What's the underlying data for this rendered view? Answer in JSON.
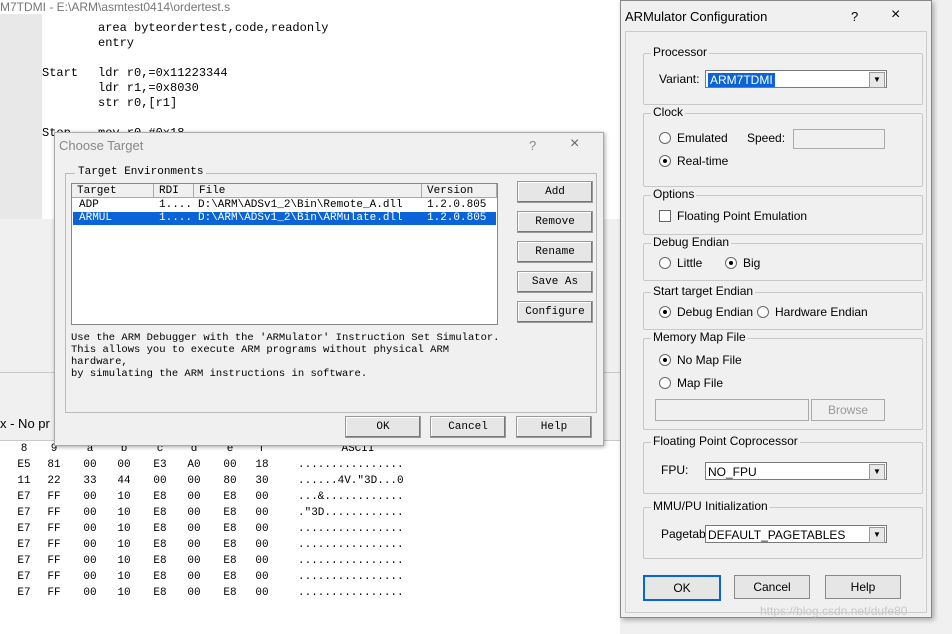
{
  "background": {
    "title": "M7TDMI - E:\\ARM\\asmtest0414\\ordertest.s",
    "code": [
      {
        "label": "",
        "text": "area byteordertest,code,readonly"
      },
      {
        "label": "",
        "text": "entry"
      },
      {
        "label": "",
        "text": ""
      },
      {
        "label": "Start",
        "text": "ldr r0,=0x11223344"
      },
      {
        "label": "",
        "text": "ldr r1,=0x8030"
      },
      {
        "label": "",
        "text": "str r0,[r1]"
      },
      {
        "label": "",
        "text": ""
      },
      {
        "label": "Stop",
        "text": "mov r0,#0x18"
      }
    ],
    "status_text": "x - No pr",
    "memory": {
      "headers": [
        "8",
        "9",
        "a",
        "b",
        "c",
        "d",
        "e",
        "f",
        "ASCII"
      ],
      "rows": [
        [
          "E5",
          "81",
          "00",
          "00",
          "E3",
          "A0",
          "00",
          "18",
          "................"
        ],
        [
          "11",
          "22",
          "33",
          "44",
          "00",
          "00",
          "80",
          "30",
          "......4V.\"3D...0"
        ],
        [
          "E7",
          "FF",
          "00",
          "10",
          "E8",
          "00",
          "E8",
          "00",
          "...&............"
        ],
        [
          "E7",
          "FF",
          "00",
          "10",
          "E8",
          "00",
          "E8",
          "00",
          ".\"3D............"
        ],
        [
          "E7",
          "FF",
          "00",
          "10",
          "E8",
          "00",
          "E8",
          "00",
          "................"
        ],
        [
          "E7",
          "FF",
          "00",
          "10",
          "E8",
          "00",
          "E8",
          "00",
          "................"
        ],
        [
          "E7",
          "FF",
          "00",
          "10",
          "E8",
          "00",
          "E8",
          "00",
          "................"
        ],
        [
          "E7",
          "FF",
          "00",
          "10",
          "E8",
          "00",
          "E8",
          "00",
          "................"
        ],
        [
          "E7",
          "FF",
          "00",
          "10",
          "E8",
          "00",
          "E8",
          "00",
          "................"
        ]
      ]
    }
  },
  "choose_target": {
    "title": "Choose Target",
    "help": "?",
    "close": "×",
    "group_label": "Target Environments",
    "columns": [
      "Target",
      "RDI",
      "File",
      "Version"
    ],
    "rows": [
      {
        "target": "ADP",
        "rdi": "1....",
        "file": "D:\\ARM\\ADSv1_2\\Bin\\Remote_A.dll",
        "version": "1.2.0.805"
      },
      {
        "target": "ARMUL",
        "rdi": "1....",
        "file": "D:\\ARM\\ADSv1_2\\Bin\\ARMulate.dll",
        "version": "1.2.0.805"
      }
    ],
    "buttons": [
      "Add",
      "Remove",
      "Rename",
      "Save As",
      "Configure"
    ],
    "description": [
      "Use the ARM Debugger with the 'ARMulator' Instruction Set Simulator.",
      "This allows you to execute ARM programs without physical ARM hardware,",
      "by simulating the ARM instructions in software."
    ],
    "ok": "OK",
    "cancel": "Cancel",
    "help_btn": "Help"
  },
  "armulator": {
    "title": "ARMulator Configuration",
    "help": "?",
    "close": "×",
    "processor": {
      "label": "Processor",
      "variant_label": "Variant:",
      "variant": "ARM7TDMI"
    },
    "clock": {
      "label": "Clock",
      "emulated": "Emulated",
      "speed_label": "Speed:",
      "realtime": "Real-time"
    },
    "options": {
      "label": "Options",
      "fpe": "Floating Point Emulation"
    },
    "debug_endian": {
      "label": "Debug Endian",
      "little": "Little",
      "big": "Big"
    },
    "start_endian": {
      "label": "Start target Endian",
      "debug": "Debug Endian",
      "hardware": "Hardware Endian"
    },
    "memory_map": {
      "label": "Memory Map File",
      "none": "No Map File",
      "map": "Map File",
      "browse": "Browse"
    },
    "fp_coproc": {
      "label": "Floating Point Coprocessor",
      "fpu_label": "FPU:",
      "fpu": "NO_FPU"
    },
    "mmu": {
      "label": "MMU/PU Initialization",
      "pagetab_label": "Pagetab",
      "pagetab": "DEFAULT_PAGETABLES"
    },
    "ok": "OK",
    "cancel": "Cancel",
    "help_btn": "Help"
  },
  "watermark": "https://blog.csdn.net/dufe80"
}
